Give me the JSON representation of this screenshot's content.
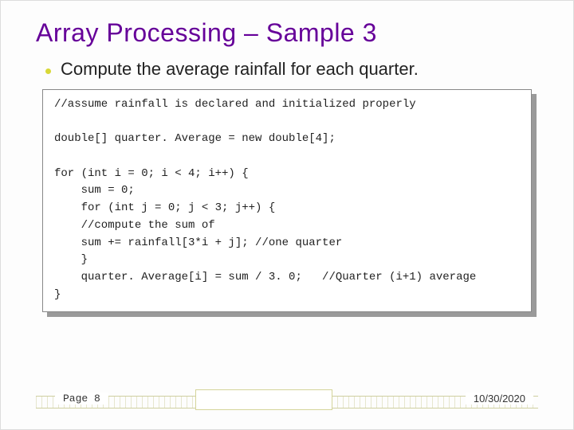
{
  "title": "Array Processing – Sample 3",
  "bullet": "Compute the average rainfall for each quarter.",
  "code": "//assume rainfall is declared and initialized properly\n\ndouble[] quarter. Average = new double[4];\n\nfor (int i = 0; i < 4; i++) {\n    sum = 0;\n    for (int j = 0; j < 3; j++) {\n    //compute the sum of\n    sum += rainfall[3*i + j]; //one quarter\n    }\n    quarter. Average[i] = sum / 3. 0;   //Quarter (i+1) average\n}",
  "footer": {
    "page": "Page 8",
    "date": "10/30/2020"
  }
}
